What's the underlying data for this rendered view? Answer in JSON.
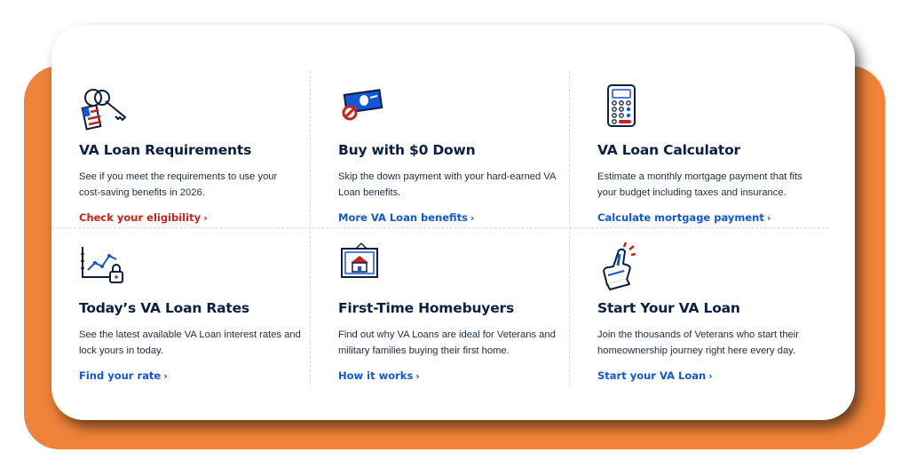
{
  "colors": {
    "orange": "#f08339",
    "navy": "#0b1f45",
    "link_blue": "#1257d6",
    "link_red": "#c8231e"
  },
  "cards": [
    {
      "icon": "keys-flag-icon",
      "title": "VA Loan Requirements",
      "desc": "See if you meet the requirements to use your cost-saving benefits in 2026.",
      "link": "Check your eligibility",
      "link_color": "#c8231e"
    },
    {
      "icon": "dollar-bill-no-icon",
      "title": "Buy with $0 Down",
      "desc": "Skip the down payment with your hard-earned VA Loan benefits.",
      "link": "More VA Loan benefits",
      "link_color": "#1257d6"
    },
    {
      "icon": "calculator-icon",
      "title": "VA Loan Calculator",
      "desc": "Estimate a monthly mortgage payment that fits your budget including taxes and insurance.",
      "link": "Calculate mortgage payment",
      "link_color": "#1257d6"
    },
    {
      "icon": "rate-chart-lock-icon",
      "title": "Today’s VA Loan Rates",
      "desc": "See the latest available VA Loan interest rates and lock yours in today.",
      "link": "Find your rate",
      "link_color": "#1257d6"
    },
    {
      "icon": "house-frame-icon",
      "title": "First-Time Homebuyers",
      "desc": "Find out why VA Loans are ideal for Veterans and military families buying their first home.",
      "link": "How it works",
      "link_color": "#1257d6"
    },
    {
      "icon": "foam-finger-icon",
      "title": "Start Your VA Loan",
      "desc": "Join the thousands of Veterans who start their homeownership journey right here every day.",
      "link": "Start your VA Loan",
      "link_color": "#1257d6"
    }
  ]
}
